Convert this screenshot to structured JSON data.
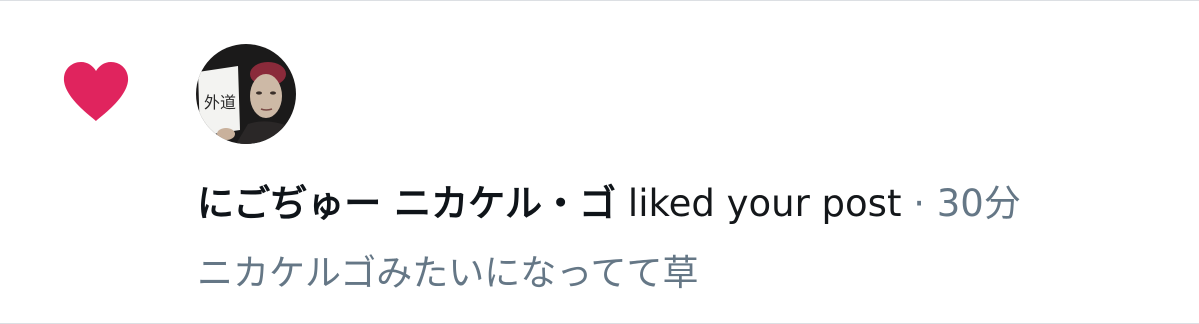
{
  "notification": {
    "type_icon": "heart-icon",
    "user_name": "にごぢゅー ニカケル・ゴ",
    "action_text": "liked your post",
    "separator": "·",
    "time": "30分",
    "post_preview": "ニカケルゴみたいになってて草",
    "avatar_sign_text": "外道"
  },
  "colors": {
    "heart": "#e0245e",
    "primary_text": "#14171a",
    "secondary_text": "#657786",
    "divider": "#dcdfe3"
  }
}
